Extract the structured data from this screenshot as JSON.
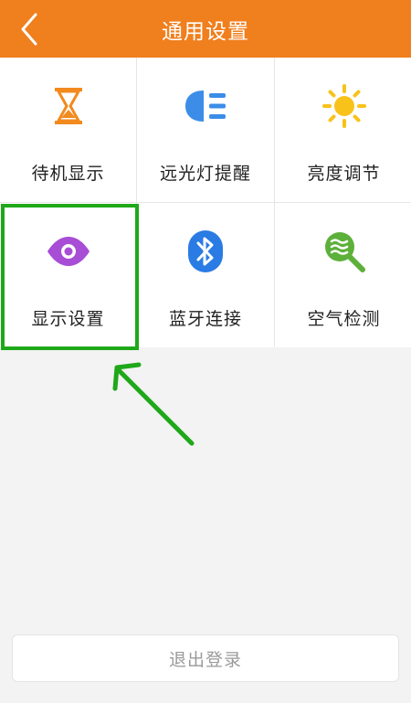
{
  "header": {
    "title": "通用设置",
    "back_icon": "chevron-left-icon"
  },
  "tiles": [
    {
      "label": "待机显示",
      "icon": "hourglass-icon",
      "color": "#f28a1e"
    },
    {
      "label": "远光灯提醒",
      "icon": "headlight-icon",
      "color": "#3b8de8"
    },
    {
      "label": "亮度调节",
      "icon": "sun-icon",
      "color": "#f8c21a"
    },
    {
      "label": "显示设置",
      "icon": "eye-icon",
      "color": "#a84dd6"
    },
    {
      "label": "蓝牙连接",
      "icon": "bluetooth-icon",
      "color": "#2a7be4"
    },
    {
      "label": "空气检测",
      "icon": "air-search-icon",
      "color": "#5db03a"
    }
  ],
  "logout": {
    "label": "退出登录"
  },
  "colors": {
    "header": "#f07f1e",
    "highlight": "#1fa81a"
  }
}
